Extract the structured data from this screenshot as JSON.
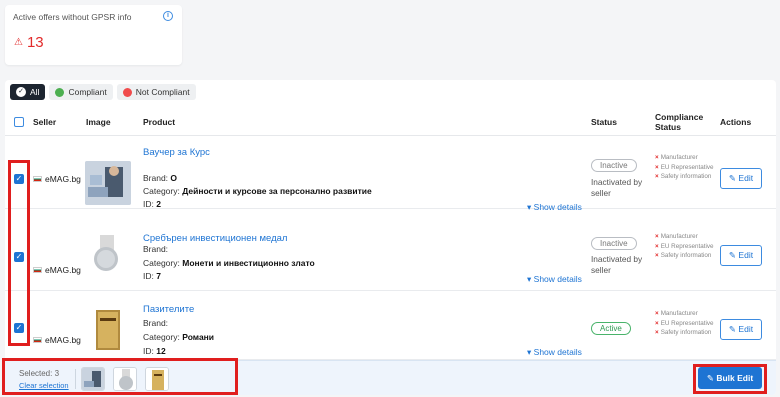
{
  "stat_card": {
    "title": "Active offers without GPSR info",
    "count": "13",
    "warn_icon": "⚠",
    "info_icon": "i"
  },
  "filters": [
    {
      "label": "All",
      "active": true
    },
    {
      "label": "Compliant",
      "color": "#4caf50"
    },
    {
      "label": "Not Compliant",
      "color": "#f04c4c"
    }
  ],
  "table": {
    "headers": {
      "seller": "Seller",
      "image": "Image",
      "product": "Product",
      "status": "Status",
      "compliance": "Compliance Status",
      "actions": "Actions"
    },
    "rows": [
      {
        "seller": "eMAG.bg",
        "name": "Ваучер за Курс",
        "brand_label": "Brand:",
        "brand": "O",
        "category_label": "Category:",
        "category": "Дейности и курсове за персонално развитие",
        "id_label": "ID:",
        "id": "2",
        "show_details": "Show details",
        "status": "Inactive",
        "status_note": "Inactivated by seller",
        "compliance": [
          "Manufacturer",
          "EU Representative",
          "Safety information"
        ],
        "edit": "Edit"
      },
      {
        "seller": "eMAG.bg",
        "name": "Сребърен инвестиционен медал",
        "brand_label": "Brand:",
        "brand": "",
        "category_label": "Category:",
        "category": "Монети и инвестиционно злато",
        "id_label": "ID:",
        "id": "7",
        "show_details": "Show details",
        "status": "Inactive",
        "status_note": "Inactivated by seller",
        "compliance": [
          "Manufacturer",
          "EU Representative",
          "Safety information"
        ],
        "edit": "Edit"
      },
      {
        "seller": "eMAG.bg",
        "name": "Пазителите",
        "brand_label": "Brand:",
        "brand": "",
        "category_label": "Category:",
        "category": "Романи",
        "id_label": "ID:",
        "id": "12",
        "show_details": "Show details",
        "status": "Active",
        "status_note": "",
        "compliance": [
          "Manufacturer",
          "EU Representative",
          "Safety information"
        ],
        "edit": "Edit"
      }
    ]
  },
  "footer": {
    "selected": "Selected: 3",
    "clear": "Clear selection",
    "bulk_edit": "Bulk Edit"
  },
  "colors": {
    "accent": "#1e74d3",
    "danger": "#e22b2b",
    "highlight": "#e01e1e"
  }
}
